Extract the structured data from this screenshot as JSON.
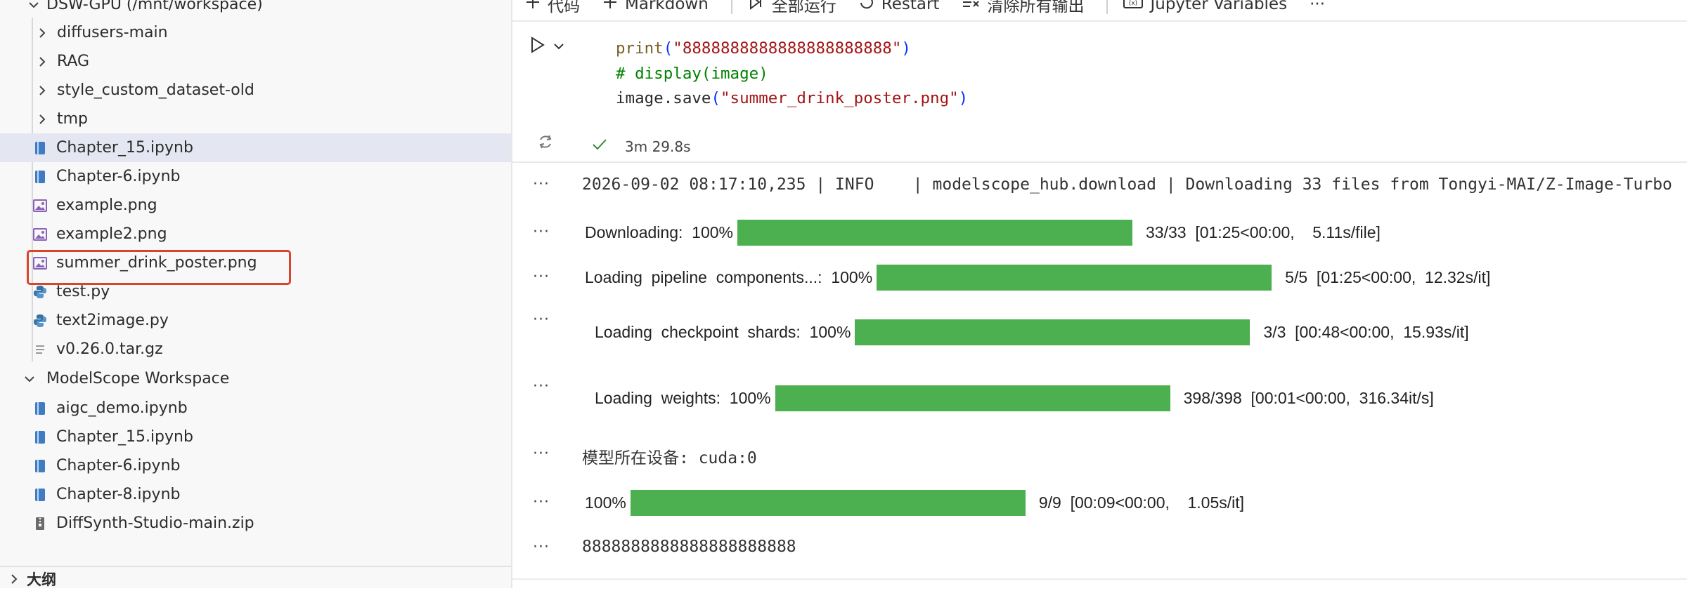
{
  "sidebar": {
    "root_folder": "DSW-GPU (/mnt/workspace)",
    "items": [
      {
        "label": "diffusers-main",
        "type": "folder"
      },
      {
        "label": "RAG",
        "type": "folder"
      },
      {
        "label": "style_custom_dataset-old",
        "type": "folder"
      },
      {
        "label": "tmp",
        "type": "folder"
      },
      {
        "label": "Chapter_15.ipynb",
        "type": "notebook",
        "selected": true
      },
      {
        "label": "Chapter-6.ipynb",
        "type": "notebook"
      },
      {
        "label": "example.png",
        "type": "image"
      },
      {
        "label": "example2.png",
        "type": "image"
      },
      {
        "label": "summer_drink_poster.png",
        "type": "image",
        "highlighted": true
      },
      {
        "label": "test.py",
        "type": "python"
      },
      {
        "label": "text2image.py",
        "type": "python"
      },
      {
        "label": "v0.26.0.tar.gz",
        "type": "archive"
      }
    ],
    "second_root": "ModelScope Workspace",
    "items2": [
      {
        "label": "aigc_demo.ipynb",
        "type": "notebook"
      },
      {
        "label": "Chapter_15.ipynb",
        "type": "notebook"
      },
      {
        "label": "Chapter-6.ipynb",
        "type": "notebook"
      },
      {
        "label": "Chapter-8.ipynb",
        "type": "notebook"
      },
      {
        "label": "DiffSynth-Studio-main.zip",
        "type": "zip"
      }
    ],
    "outline_label": "大纲"
  },
  "toolbar": {
    "code": "代码",
    "markdown": "Markdown",
    "run_all": "全部运行",
    "restart": "Restart",
    "clear_outputs": "清除所有输出",
    "jupyter_variables": "Jupyter Variables",
    "more": "···"
  },
  "cell": {
    "code": {
      "line1_fn": "print",
      "line1_open": "(",
      "line1_str": "\"8888888888888888888888\"",
      "line1_close": ")",
      "line2_comment": "# display(image)",
      "line3_obj": "image.save",
      "line3_open": "(",
      "line3_str": "\"summer_drink_poster.png\"",
      "line3_close": ")"
    },
    "exec_time": "3m 29.8s"
  },
  "outputs": {
    "log_line": "2026-09-02 08:17:10,235 | INFO    | modelscope_hub.download | Downloading 33 files from Tongyi-MAI/Z-Image-Turbo",
    "progress": [
      {
        "label": "Downloading:  100%",
        "stats": "33/33  [01:25<00:00,    5.11s/file]",
        "fraction": 1.0
      },
      {
        "label": "Loading  pipeline  components...:  100%",
        "stats": "5/5  [01:25<00:00,  12.32s/it]",
        "fraction": 1.0
      },
      {
        "label": "Loading  checkpoint  shards:  100%",
        "stats": "3/3  [00:48<00:00,  15.93s/it]",
        "fraction": 1.0
      },
      {
        "label": "Loading  weights:  100%",
        "stats": "398/398  [00:01<00:00,  316.34it/s]",
        "fraction": 1.0
      },
      {
        "label": "100%",
        "stats": "9/9  [00:09<00:00,    1.05s/it]",
        "fraction": 1.0
      }
    ],
    "device_line": "模型所在设备: cuda:0",
    "print_line": "8888888888888888888888"
  },
  "colors": {
    "progress_bar": "#4caf50",
    "highlight_box": "#d9442b",
    "selection": "#e4e6f1"
  }
}
